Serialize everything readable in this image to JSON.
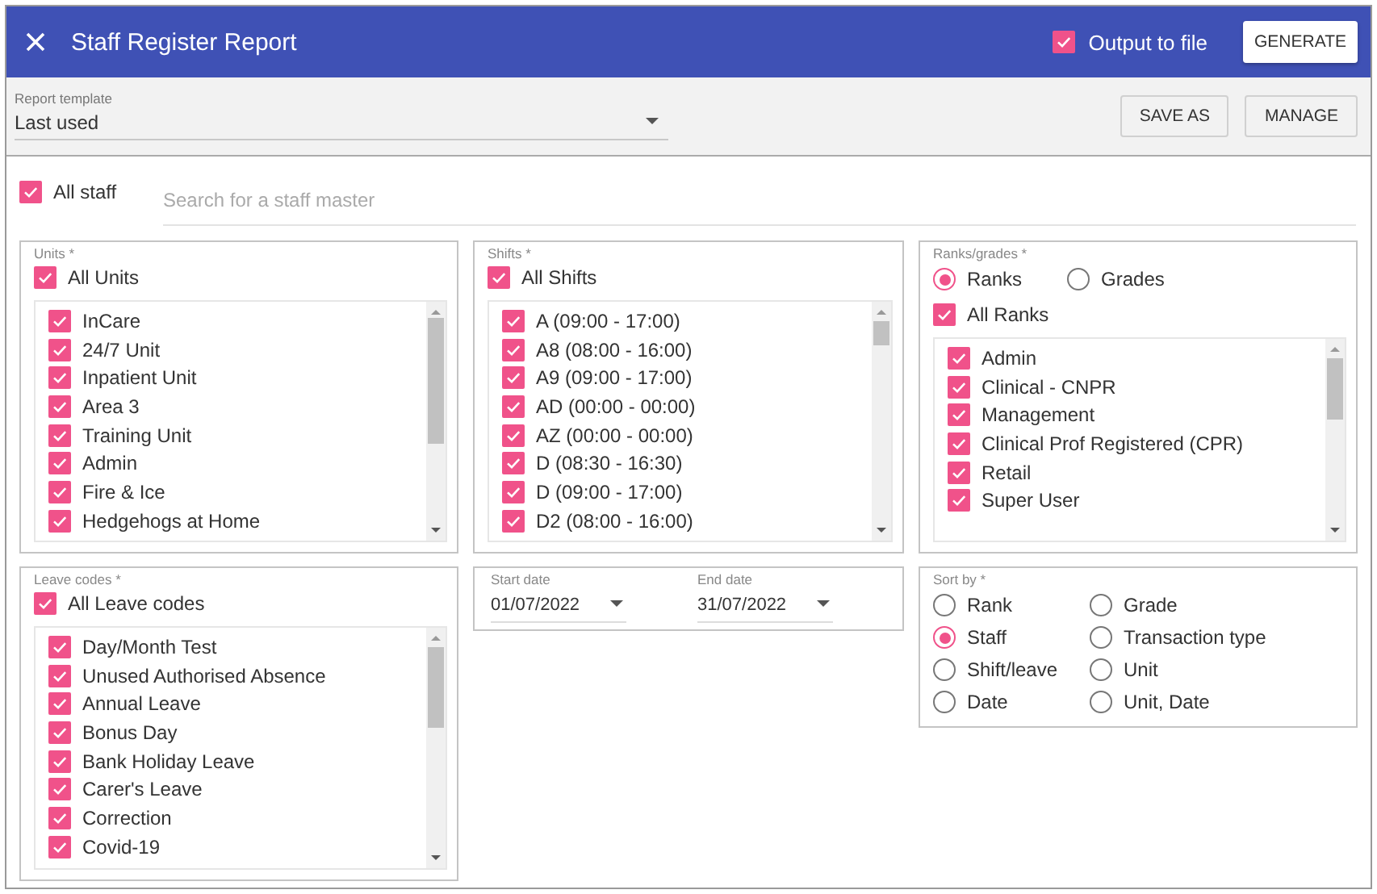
{
  "header": {
    "title": "Staff Register Report",
    "output_to_file": {
      "label": "Output to file",
      "checked": true
    },
    "generate_button": "GENERATE"
  },
  "template": {
    "label": "Report template",
    "value": "Last used",
    "buttons": [
      "SAVE AS",
      "MANAGE"
    ]
  },
  "staff": {
    "all_staff": {
      "label": "All staff",
      "checked": true
    },
    "search": {
      "placeholder": "Search for a staff master"
    }
  },
  "units": {
    "label": "Units *",
    "all": {
      "label": "All Units",
      "checked": true
    },
    "items": [
      {
        "label": "InCare",
        "checked": true
      },
      {
        "label": "24/7 Unit",
        "checked": true
      },
      {
        "label": "Inpatient Unit",
        "checked": true
      },
      {
        "label": "Area 3",
        "checked": true
      },
      {
        "label": "Training Unit",
        "checked": true
      },
      {
        "label": "Admin",
        "checked": true
      },
      {
        "label": "Fire & Ice",
        "checked": true
      },
      {
        "label": "Hedgehogs at Home",
        "checked": true
      }
    ]
  },
  "shifts": {
    "label": "Shifts *",
    "all": {
      "label": "All Shifts",
      "checked": true
    },
    "items": [
      {
        "label": "A (09:00 - 17:00)",
        "checked": true
      },
      {
        "label": "A8 (08:00 - 16:00)",
        "checked": true
      },
      {
        "label": "A9 (09:00 - 17:00)",
        "checked": true
      },
      {
        "label": "AD (00:00 - 00:00)",
        "checked": true
      },
      {
        "label": "AZ (00:00 - 00:00)",
        "checked": true
      },
      {
        "label": "D (08:30 - 16:30)",
        "checked": true
      },
      {
        "label": "D (09:00 - 17:00)",
        "checked": true
      },
      {
        "label": "D2 (08:00 - 16:00)",
        "checked": true
      }
    ]
  },
  "ranks_grades": {
    "label": "Ranks/grades *",
    "modes": [
      {
        "label": "Ranks",
        "selected": true
      },
      {
        "label": "Grades",
        "selected": false
      }
    ],
    "all": {
      "label": "All Ranks",
      "checked": true
    },
    "items": [
      {
        "label": "Admin",
        "checked": true
      },
      {
        "label": "Clinical - CNPR",
        "checked": true
      },
      {
        "label": "Management",
        "checked": true
      },
      {
        "label": "Clinical Prof Registered (CPR)",
        "checked": true
      },
      {
        "label": "Retail",
        "checked": true
      },
      {
        "label": "Super User",
        "checked": true
      }
    ]
  },
  "leave_codes": {
    "label": "Leave codes *",
    "all": {
      "label": "All Leave codes",
      "checked": true
    },
    "items": [
      {
        "label": "Day/Month Test",
        "checked": true
      },
      {
        "label": "Unused Authorised Absence",
        "checked": true
      },
      {
        "label": "Annual Leave",
        "checked": true
      },
      {
        "label": "Bonus Day",
        "checked": true
      },
      {
        "label": "Bank Holiday Leave",
        "checked": true
      },
      {
        "label": "Carer's Leave",
        "checked": true
      },
      {
        "label": "Correction",
        "checked": true
      },
      {
        "label": "Covid-19",
        "checked": true
      }
    ]
  },
  "dates": {
    "start": {
      "label": "Start date",
      "value": "01/07/2022"
    },
    "end": {
      "label": "End date",
      "value": "31/07/2022"
    }
  },
  "sort_by": {
    "label": "Sort by *",
    "options": [
      {
        "label": "Rank",
        "selected": false
      },
      {
        "label": "Grade",
        "selected": false
      },
      {
        "label": "Staff",
        "selected": true
      },
      {
        "label": "Transaction type",
        "selected": false
      },
      {
        "label": "Shift/leave",
        "selected": false
      },
      {
        "label": "Unit",
        "selected": false
      },
      {
        "label": "Date",
        "selected": false
      },
      {
        "label": "Unit, Date",
        "selected": false
      }
    ]
  }
}
